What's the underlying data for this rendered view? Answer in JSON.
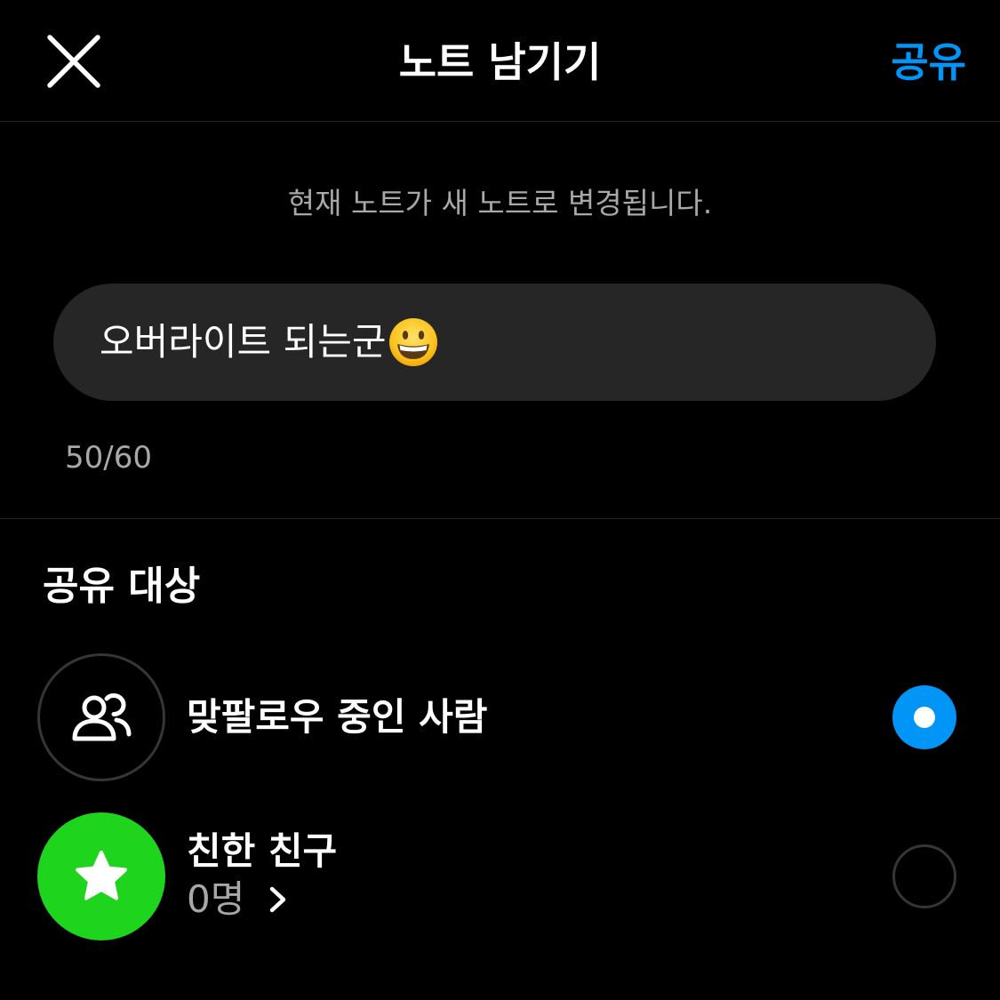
{
  "header": {
    "title": "노트 남기기",
    "share_label": "공유",
    "close_icon": "close-icon"
  },
  "notice": "현재 노트가 새 노트로 변경됩니다.",
  "note": {
    "text": "오버라이트 되는군",
    "emoji": "grinning-face-emoji",
    "char_count": "50/60"
  },
  "audience": {
    "title": "공유 대상",
    "options": [
      {
        "label": "맞팔로우 중인 사람",
        "icon": "people-icon",
        "selected": true
      },
      {
        "label": "친한 친구",
        "sublabel": "0명",
        "icon": "star-icon",
        "selected": false
      }
    ]
  },
  "colors": {
    "background": "#000000",
    "accent": "#0095f6",
    "input_bg": "#262626",
    "secondary_text": "#a8a8a8",
    "close_friends_green": "#1fd41c"
  }
}
